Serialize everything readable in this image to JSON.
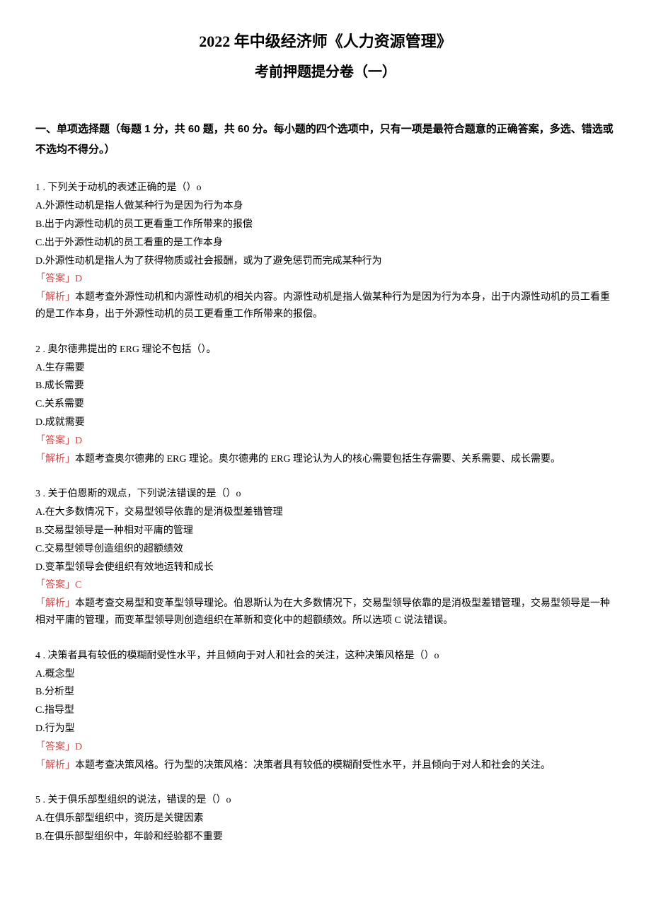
{
  "header": {
    "title": "2022 年中级经济师《人力资源管理》",
    "subtitle": "考前押题提分卷（一）"
  },
  "section_header": "一、单项选择题（每题 1 分，共 60 题，共 60 分。每小题的四个选项中，只有一项是最符合题意的正确答案，多选、错选或不选均不得分。）",
  "questions": [
    {
      "stem": "1 . 下列关于动机的表述正确的是（）o",
      "options": [
        "A.外源性动机是指人做某种行为是因为行为本身",
        "B.出于内源性动机的员工更看重工作所带来的报偿",
        "C.出于外源性动机的员工看重的是工作本身",
        "D.外源性动机是指人为了获得物质或社会报酬，或为了避免惩罚而完成某种行为"
      ],
      "answer_label": "「答案」D",
      "analysis_label": "「解析」",
      "analysis_text": "本题考查外源性动机和内源性动机的相关内容。内源性动机是指人做某种行为是因为行为本身，出于内源性动机的员工看重的是工作本身，出于外源性动机的员工更看重工作所带来的报偿。"
    },
    {
      "stem": "2 . 奥尔德弗提出的 ERG 理论不包括（）。",
      "options": [
        "A.生存需要",
        "B.成长需要",
        "C.关系需要",
        "D.成就需要"
      ],
      "answer_label": "「答案」D",
      "analysis_label": "「解析」",
      "analysis_text": "本题考查奥尔德弗的 ERG 理论。奥尔德弗的 ERG 理论认为人的核心需要包括生存需要、关系需要、成长需要。"
    },
    {
      "stem": "3 . 关于伯恩斯的观点，下列说法错误的是（）o",
      "options": [
        "A.在大多数情况下，交易型领导依靠的是消极型差错管理",
        "B.交易型领导是一种相对平庸的管理",
        "C.交易型领导创造组织的超额绩效",
        "D.变革型领导会使组织有效地运转和成长"
      ],
      "answer_label": "「答案」C",
      "analysis_label": "「解析」",
      "analysis_text": "本题考查交易型和变革型领导理论。伯恩斯认为在大多数情况下，交易型领导依靠的是消极型差错管理，交易型领导是一种相对平庸的管理，而变革型领导则创造组织在革新和变化中的超额绩效。所以选项 C 说法错误。"
    },
    {
      "stem": "4 . 决策者具有较低的模糊耐受性水平，并且倾向于对人和社会的关注，这种决策风格是（）o",
      "options": [
        "A.概念型",
        "B.分析型",
        "C.指导型",
        "D.行为型"
      ],
      "answer_label": "「答案」D",
      "analysis_label": "「解析」",
      "analysis_text": "本题考查决策风格。行为型的决策风格：决策者具有较低的模糊耐受性水平，并且倾向于对人和社会的关注。"
    },
    {
      "stem": "5 . 关于俱乐部型组织的说法，错误的是（）o",
      "options": [
        "A.在俱乐部型组织中，资历是关键因素",
        "B.在俱乐部型组织中，年龄和经验都不重要"
      ],
      "answer_label": "",
      "analysis_label": "",
      "analysis_text": ""
    }
  ]
}
